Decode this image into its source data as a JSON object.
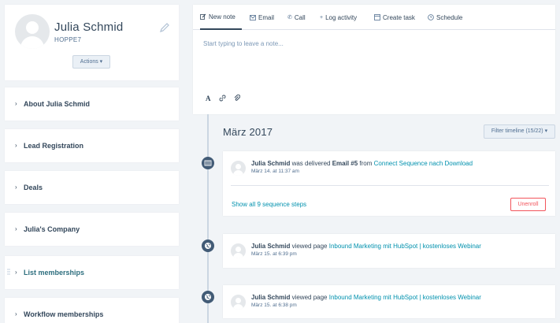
{
  "profile": {
    "name": "Julia Schmid",
    "company_code": "HOPPE7",
    "actions_label": "Actions ▾"
  },
  "sections": [
    {
      "label": "About Julia Schmid"
    },
    {
      "label": "Lead Registration"
    },
    {
      "label": "Deals"
    },
    {
      "label": "Julia's Company"
    },
    {
      "label": "List memberships"
    },
    {
      "label": "Workflow memberships"
    }
  ],
  "composer": {
    "tabs": [
      {
        "label": "New note",
        "icon": "pencil-square-icon"
      },
      {
        "label": "Email",
        "icon": "envelope-icon"
      },
      {
        "label": "Call",
        "icon": "phone-icon"
      },
      {
        "label": "Log activity",
        "icon": "plus-icon"
      },
      {
        "label": "Create task",
        "icon": "task-icon"
      },
      {
        "label": "Schedule",
        "icon": "clock-icon"
      }
    ],
    "placeholder": "Start typing to leave a note..."
  },
  "timeline": {
    "month": "März 2017",
    "filter_label": "Filter timeline (15/22) ▾",
    "events": [
      {
        "name": "Julia Schmid",
        "text_before": " was delivered ",
        "strong": "Email #5",
        "text_mid": " from ",
        "link": "Connect Sequence nach Download",
        "date": "März 14. at 11:37 am",
        "show_link": "Show all 9 sequence steps",
        "unenroll_label": "Unenroll",
        "icon": "sequence-icon"
      },
      {
        "name": "Julia Schmid",
        "text_before": " viewed page ",
        "link": "Inbound Marketing mit HubSpot | kostenloses Webinar",
        "date": "März 15. at 6:39 pm",
        "icon": "globe-icon"
      },
      {
        "name": "Julia Schmid",
        "text_before": " viewed page ",
        "link": "Inbound Marketing mit HubSpot | kostenloses Webinar",
        "date": "März 15. at 6:38 pm",
        "icon": "globe-icon"
      }
    ]
  },
  "colors": {
    "background": "#f1f4f7",
    "text": "#33475b",
    "link": "#0091ae",
    "danger": "#f2545b",
    "timeline_dot": "#425b76"
  }
}
